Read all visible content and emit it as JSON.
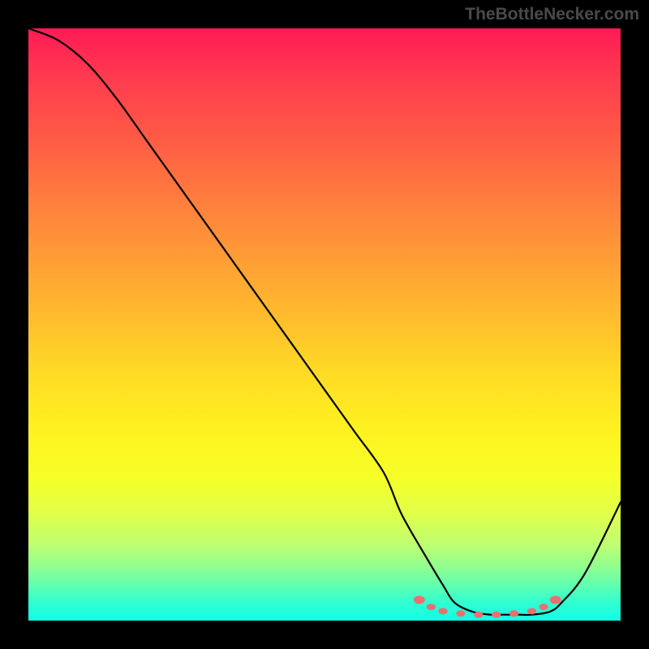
{
  "watermark": "TheBottleNecker.com",
  "chart_data": {
    "type": "line",
    "title": "",
    "xlabel": "",
    "ylabel": "",
    "xlim": [
      0,
      100
    ],
    "ylim": [
      0,
      100
    ],
    "x": [
      0,
      5,
      10,
      15,
      20,
      25,
      30,
      35,
      40,
      45,
      50,
      55,
      60,
      63,
      67,
      70,
      72,
      75,
      78,
      80,
      83,
      85,
      88,
      90,
      94,
      100
    ],
    "y": [
      100,
      98,
      94,
      88,
      81,
      74,
      67,
      60,
      53,
      46,
      39,
      32,
      25,
      18,
      11,
      6,
      3,
      1.5,
      1,
      1,
      1,
      1,
      1.5,
      3,
      8,
      20
    ],
    "markers": {
      "x": [
        66,
        68,
        70,
        73,
        76,
        79,
        82,
        85,
        87,
        89
      ],
      "y": [
        3.5,
        2.3,
        1.6,
        1.2,
        1.0,
        1.0,
        1.2,
        1.6,
        2.3,
        3.5
      ]
    },
    "gradient_colors": {
      "top": "#ff1a55",
      "mid": "#fff21f",
      "bottom": "#10ffe8"
    }
  }
}
